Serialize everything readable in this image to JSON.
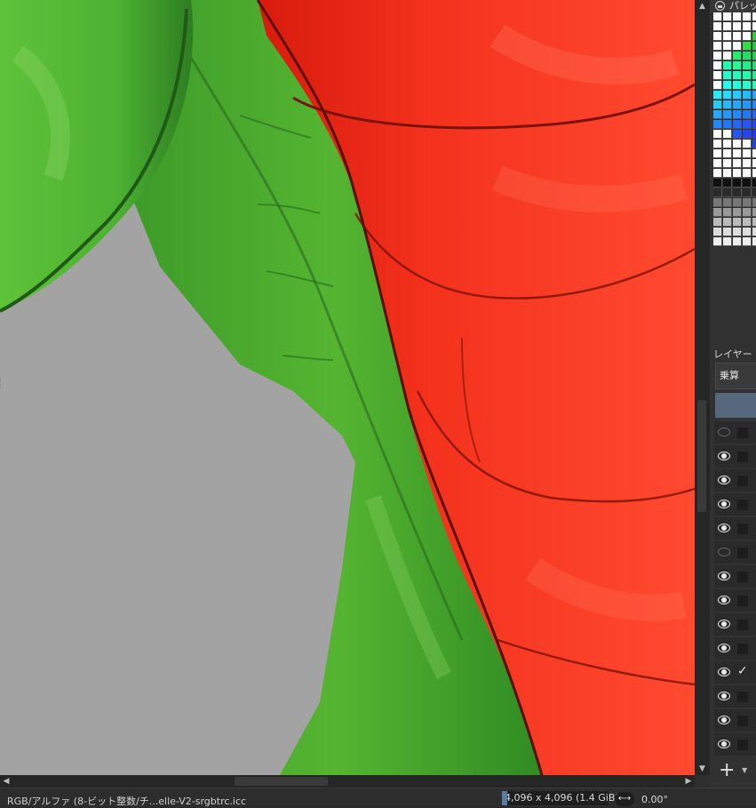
{
  "palette": {
    "title": "パレット",
    "rows": [
      [
        "#ffffff",
        "#ffffff",
        "#ffffff",
        "#ffffff",
        "#ffffff"
      ],
      [
        "#ffffff",
        "#ffffff",
        "#ffffff",
        "#ffffff",
        "#ffffff"
      ],
      [
        "#ffffff",
        "#ffffff",
        "#ffffff",
        "#ffffff",
        "#33cc33"
      ],
      [
        "#ffffff",
        "#ffffff",
        "#ffffff",
        "#33dd44",
        "#22cc44"
      ],
      [
        "#ffffff",
        "#ffffff",
        "#22ee66",
        "#22dd66",
        "#22cc55"
      ],
      [
        "#ffffff",
        "#22ffaa",
        "#22ff99",
        "#22ee88",
        "#22dd77"
      ],
      [
        "#ffffff",
        "#22ffcc",
        "#22ffbb",
        "#22ffaa",
        "#22ee99"
      ],
      [
        "#ffffff",
        "#22ffee",
        "#22ffdd",
        "#22ffcc",
        "#22ffbb"
      ],
      [
        "#22eeff",
        "#22ddff",
        "#22ccff",
        "#22bbff",
        "#22aaff"
      ],
      [
        "#22ccff",
        "#22bbff",
        "#22aaff",
        "#2299ff",
        "#2288ff"
      ],
      [
        "#22aaff",
        "#2299ff",
        "#2288ff",
        "#2277ff",
        "#2266ff"
      ],
      [
        "#2288ff",
        "#2277ff",
        "#2266ff",
        "#2255ff",
        "#2244ff"
      ],
      [
        "#ffffff",
        "#ffffff",
        "#2255ff",
        "#2244ff",
        "#2233ff"
      ],
      [
        "#ffffff",
        "#ffffff",
        "#ffffff",
        "#ffffff",
        "#2244ee"
      ],
      [
        "#ffffff",
        "#ffffff",
        "#ffffff",
        "#ffffff",
        "#ffffff"
      ],
      [
        "#ffffff",
        "#ffffff",
        "#ffffff",
        "#ffffff",
        "#ffffff"
      ],
      [
        "#ffffff",
        "#ffffff",
        "#ffffff",
        "#ffffff",
        "#ffffff"
      ],
      [
        "#111111",
        "#111111",
        "#111111",
        "#111111",
        "#111111"
      ],
      [
        "#2a2a2a",
        "#2a2a2a",
        "#2a2a2a",
        "#2a2a2a",
        "#2a2a2a"
      ],
      [
        "#777777",
        "#777777",
        "#777777",
        "#777777",
        "#777777"
      ],
      [
        "#999999",
        "#999999",
        "#999999",
        "#999999",
        "#999999"
      ],
      [
        "#bbbbbb",
        "#bbbbbb",
        "#bbbbbb",
        "#bbbbbb",
        "#bbbbbb"
      ],
      [
        "#dddddd",
        "#dddddd",
        "#dddddd",
        "#dddddd",
        "#dddddd"
      ],
      [
        "#eeeeee",
        "#eeeeee",
        "#eeeeee",
        "#eeeeee",
        "#eeeeee"
      ]
    ]
  },
  "layers": {
    "header": "レイヤー",
    "blend_mode": "乗算",
    "rows": [
      {
        "visible": false,
        "checked": false
      },
      {
        "visible": true,
        "checked": false
      },
      {
        "visible": true,
        "checked": false
      },
      {
        "visible": true,
        "checked": false
      },
      {
        "visible": true,
        "checked": false
      },
      {
        "visible": false,
        "checked": false
      },
      {
        "visible": true,
        "checked": false
      },
      {
        "visible": true,
        "checked": false
      },
      {
        "visible": true,
        "checked": false
      },
      {
        "visible": true,
        "checked": false
      },
      {
        "visible": true,
        "checked": true
      },
      {
        "visible": true,
        "checked": false
      },
      {
        "visible": true,
        "checked": false
      },
      {
        "visible": true,
        "checked": false
      }
    ],
    "add_label": "+"
  },
  "status": {
    "color_profile": "RGB/アルファ (8-ビット整数/チ...elle-V2-srgbtrc.icc",
    "image_size": "4,096 x 4,096 (1.4 GiB)",
    "rotation": "0.00°"
  },
  "colors": {
    "canvas_bg": "#a3a3a3",
    "green": "#3fa02a",
    "red": "#f2331c",
    "accent": "#57687d"
  }
}
